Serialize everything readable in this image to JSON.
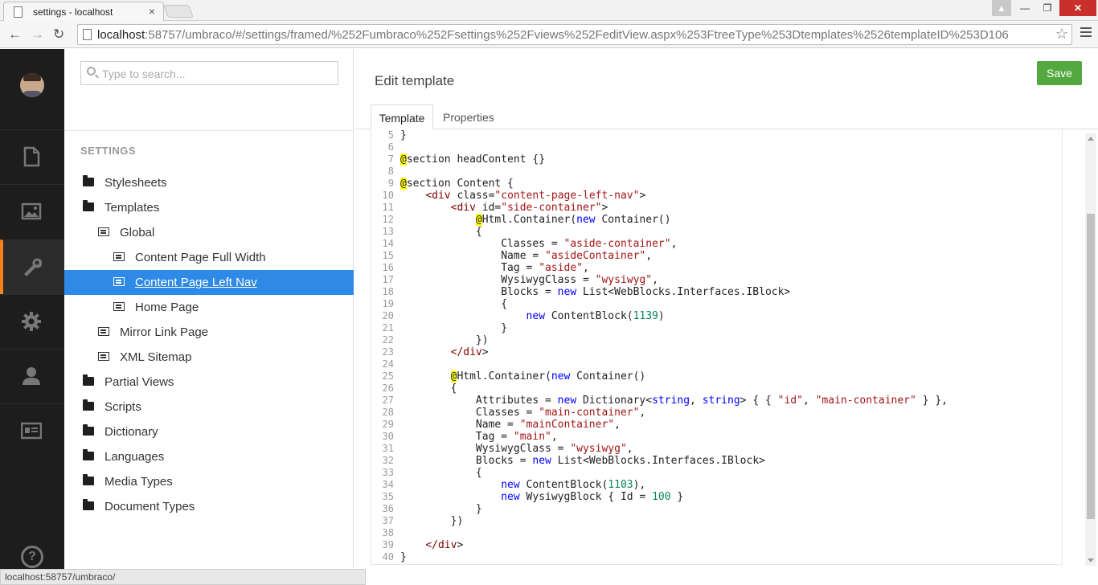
{
  "browser": {
    "tab_title": "settings - localhost",
    "tab_close": "×",
    "url_host": "localhost",
    "url_rest": ":58757/umbraco/#/settings/framed/%252Fumbraco%252Fsettings%252Fviews%252FeditView.aspx%253FtreeType%253Dtemplates%2526templateID%253D106",
    "status_url": "localhost:58757/umbraco/",
    "nav": {
      "back": "←",
      "forward": "→",
      "reload": "↻"
    },
    "window": {
      "user": "▲",
      "min": "—",
      "max": "❐",
      "close": "✕"
    }
  },
  "tree": {
    "search_placeholder": "Type to search...",
    "section_title": "SETTINGS",
    "nodes": [
      {
        "label": "Stylesheets",
        "type": "folder"
      },
      {
        "label": "Templates",
        "type": "folder"
      },
      {
        "label": "Global",
        "type": "template"
      },
      {
        "label": "Content Page Full Width",
        "type": "template"
      },
      {
        "label": "Content Page Left Nav",
        "type": "template",
        "selected": true
      },
      {
        "label": "Home Page",
        "type": "template"
      },
      {
        "label": "Mirror Link Page",
        "type": "template"
      },
      {
        "label": "XML Sitemap",
        "type": "template"
      },
      {
        "label": "Partial Views",
        "type": "folder"
      },
      {
        "label": "Scripts",
        "type": "folder"
      },
      {
        "label": "Dictionary",
        "type": "folder"
      },
      {
        "label": "Languages",
        "type": "folder"
      },
      {
        "label": "Media Types",
        "type": "folder"
      },
      {
        "label": "Document Types",
        "type": "folder"
      }
    ]
  },
  "appbar": {
    "items": [
      "content-icon",
      "media-icon",
      "settings-wrench-icon",
      "developer-gear-icon",
      "users-icon",
      "members-icon"
    ],
    "active": "settings-wrench-icon",
    "accent_color": "#f5821f",
    "help": "?"
  },
  "editor": {
    "title": "Edit template",
    "save_label": "Save",
    "tabs": [
      "Template",
      "Properties"
    ],
    "code_lines": [
      {
        "n": "5",
        "text": "}"
      },
      {
        "n": "6",
        "text": ""
      },
      {
        "n": "7",
        "text": "@section headContent {}"
      },
      {
        "n": "8",
        "text": ""
      },
      {
        "n": "9",
        "text": "@section Content {"
      },
      {
        "n": "10",
        "text": "    <div class=\"content-page-left-nav\">"
      },
      {
        "n": "11",
        "text": "        <div id=\"side-container\">"
      },
      {
        "n": "12",
        "text": "            @Html.Container(new Container()"
      },
      {
        "n": "13",
        "text": "            {"
      },
      {
        "n": "14",
        "text": "                Classes = \"aside-container\","
      },
      {
        "n": "15",
        "text": "                Name = \"asideContainer\","
      },
      {
        "n": "16",
        "text": "                Tag = \"aside\","
      },
      {
        "n": "17",
        "text": "                WysiwygClass = \"wysiwyg\","
      },
      {
        "n": "18",
        "text": "                Blocks = new List<WebBlocks.Interfaces.IBlock>"
      },
      {
        "n": "19",
        "text": "                {"
      },
      {
        "n": "20",
        "text": "                    new ContentBlock(1139)"
      },
      {
        "n": "21",
        "text": "                }"
      },
      {
        "n": "22",
        "text": "            })"
      },
      {
        "n": "23",
        "text": "        </div>"
      },
      {
        "n": "24",
        "text": ""
      },
      {
        "n": "25",
        "text": "        @Html.Container(new Container()"
      },
      {
        "n": "26",
        "text": "        {"
      },
      {
        "n": "27",
        "text": "            Attributes = new Dictionary<string, string> { { \"id\", \"main-container\" } },"
      },
      {
        "n": "28",
        "text": "            Classes = \"main-container\","
      },
      {
        "n": "29",
        "text": "            Name = \"mainContainer\","
      },
      {
        "n": "30",
        "text": "            Tag = \"main\","
      },
      {
        "n": "31",
        "text": "            WysiwygClass = \"wysiwyg\","
      },
      {
        "n": "32",
        "text": "            Blocks = new List<WebBlocks.Interfaces.IBlock>"
      },
      {
        "n": "33",
        "text": "            {"
      },
      {
        "n": "34",
        "text": "                new ContentBlock(1103),"
      },
      {
        "n": "35",
        "text": "                new WysiwygBlock { Id = 100 }"
      },
      {
        "n": "36",
        "text": "            }"
      },
      {
        "n": "37",
        "text": "        })"
      },
      {
        "n": "38",
        "text": ""
      },
      {
        "n": "39",
        "text": "    </div>"
      },
      {
        "n": "40",
        "text": "}"
      }
    ]
  },
  "colors": {
    "selected_bg": "#2e8ae6",
    "save_bg": "#53a93f",
    "appbar_bg": "#1d1d1d"
  }
}
